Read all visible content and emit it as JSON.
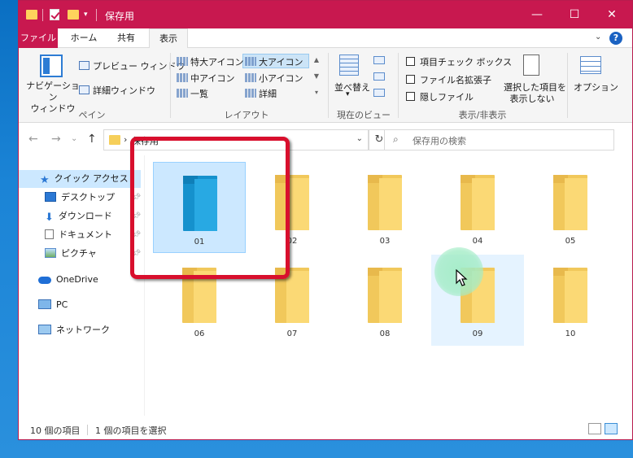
{
  "window": {
    "title": "保存用",
    "minimize": "—",
    "maximize": "☐",
    "close": "✕"
  },
  "tabs": [
    "ファイル",
    "ホーム",
    "共有",
    "表示"
  ],
  "ribbon": {
    "pane_group": {
      "nav_pane_label": "ナビゲーション\nウィンドウ",
      "nav_pane_drop": "▾",
      "preview_label": "プレビュー ウィンドウ",
      "details_label": "詳細ウィンドウ",
      "group_label": "ペイン"
    },
    "layout_group": {
      "items": [
        "特大アイコン",
        "大アイコン",
        "中アイコン",
        "小アイコン",
        "一覧",
        "詳細"
      ],
      "selected": "大アイコン",
      "group_label": "レイアウト"
    },
    "view_group": {
      "sort_label": "並べ替え",
      "group_label": "現在のビュー"
    },
    "showhide_group": {
      "item_checkbox": "項目チェック ボックス",
      "file_ext": "ファイル名拡張子",
      "hidden_files": "隠しファイル",
      "hide_selected_line1": "選択した項目を",
      "hide_selected_line2": "表示しない",
      "group_label": "表示/非表示"
    },
    "options_label": "オプション",
    "help": "?"
  },
  "navbar": {
    "back": "←",
    "forward": "→",
    "history": "⌄",
    "up": "↑",
    "address": "保存用",
    "search_placeholder": "保存用の検索"
  },
  "navpane": {
    "items": [
      {
        "label": "クイック アクセス",
        "icon": "star-icon"
      },
      {
        "label": "デスクトップ",
        "icon": "desktop-icon"
      },
      {
        "label": "ダウンロード",
        "icon": "download-icon"
      },
      {
        "label": "ドキュメント",
        "icon": "document-icon"
      },
      {
        "label": "ピクチャ",
        "icon": "picture-icon"
      },
      {
        "label": "OneDrive",
        "icon": "cloud-icon"
      },
      {
        "label": "PC",
        "icon": "pc-icon"
      },
      {
        "label": "ネットワーク",
        "icon": "network-icon"
      }
    ]
  },
  "folders": [
    "01",
    "02",
    "03",
    "04",
    "05",
    "06",
    "07",
    "08",
    "09",
    "10"
  ],
  "status": {
    "count": "10 個の項目",
    "selected": "1 個の項目を選択"
  },
  "colors": {
    "titlebar": "#c8184f",
    "highlight": "#d80f2d",
    "selection": "#cce8ff"
  }
}
